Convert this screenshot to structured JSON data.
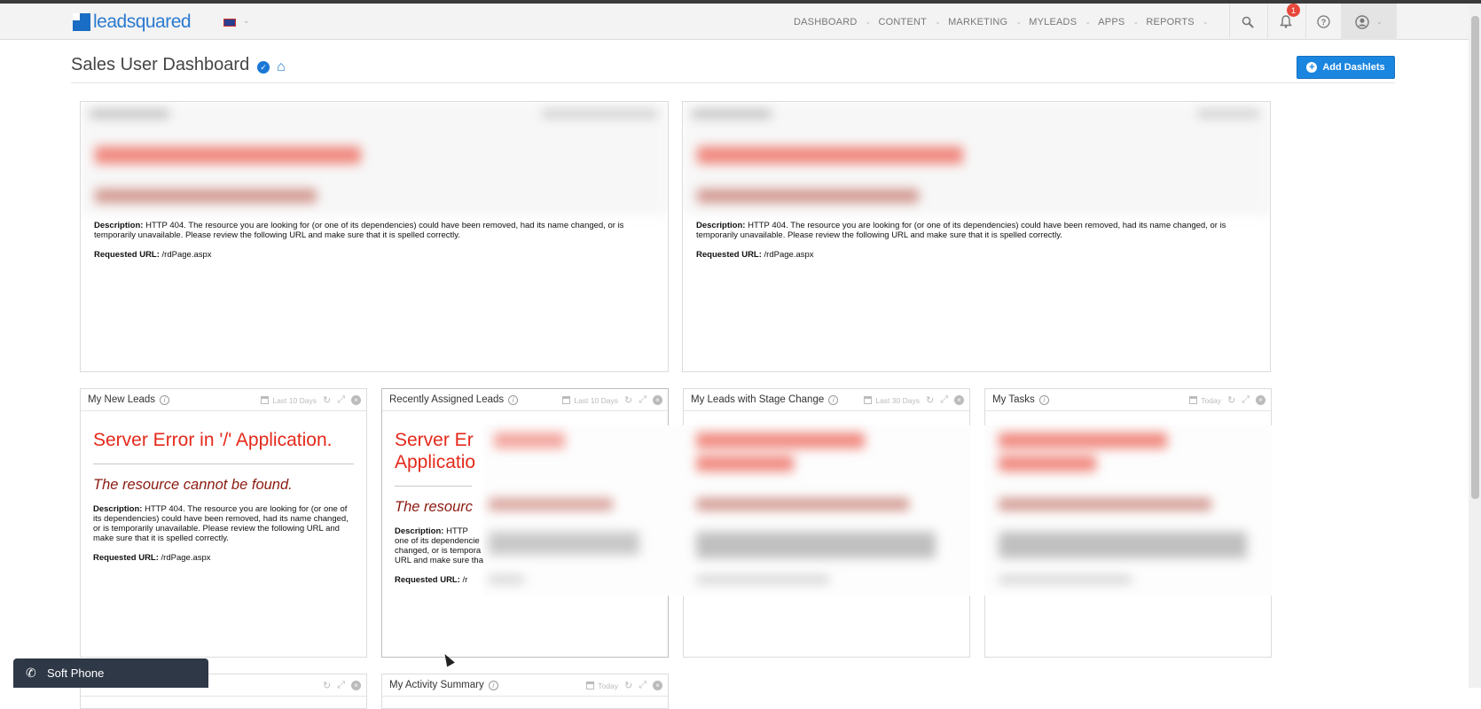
{
  "app": {
    "logo_text": "leadsquared",
    "page_title": "Sales User Dashboard",
    "add_button_label": "Add Dashlets",
    "notification_count": "1"
  },
  "nav": {
    "items": [
      {
        "label": "DASHBOARD"
      },
      {
        "label": "CONTENT"
      },
      {
        "label": "MARKETING"
      },
      {
        "label": "MYLEADS"
      },
      {
        "label": "APPS"
      },
      {
        "label": "REPORTS"
      }
    ]
  },
  "error": {
    "title": "Server Error in '/' Application.",
    "subtitle": "The resource cannot be found.",
    "desc_label": "Description:",
    "desc_text": " HTTP 404. The resource you are looking for (or one of its dependencies) could have been removed, had its name changed, or is temporarily unavailable.  Please review the following URL and make sure that it is spelled correctly.",
    "url_label": "Requested URL:",
    "url_value": " /rdPage.aspx"
  },
  "dashlets": {
    "top_left": {
      "title": ""
    },
    "top_right": {
      "title": ""
    },
    "d1": {
      "title": "My New Leads",
      "range": "Last 10 Days"
    },
    "d2": {
      "title": "Recently Assigned Leads",
      "range": "Last 10 Days",
      "title_error_partial": "Server Er",
      "app_partial": "Applicatio",
      "sub_partial": "The resourc",
      "desc_partial_1": " HTTP",
      "desc_partial_2": "one of its dependencie",
      "desc_partial_3": "changed, or is tempora",
      "desc_partial_4": "URL and make sure tha",
      "url_partial": " /r"
    },
    "d3": {
      "title": "My Leads with Stage Change",
      "range": "Last 30 Days"
    },
    "d4": {
      "title": "My Tasks",
      "range": "Today"
    },
    "d5": {
      "title": ""
    },
    "d6": {
      "title": "My Activity Summary",
      "range": "Today"
    }
  },
  "softphone": {
    "label": "Soft Phone"
  },
  "colors": {
    "accent": "#1a86e0",
    "error_red": "#e4291b",
    "error_dark": "#8b1a10"
  }
}
